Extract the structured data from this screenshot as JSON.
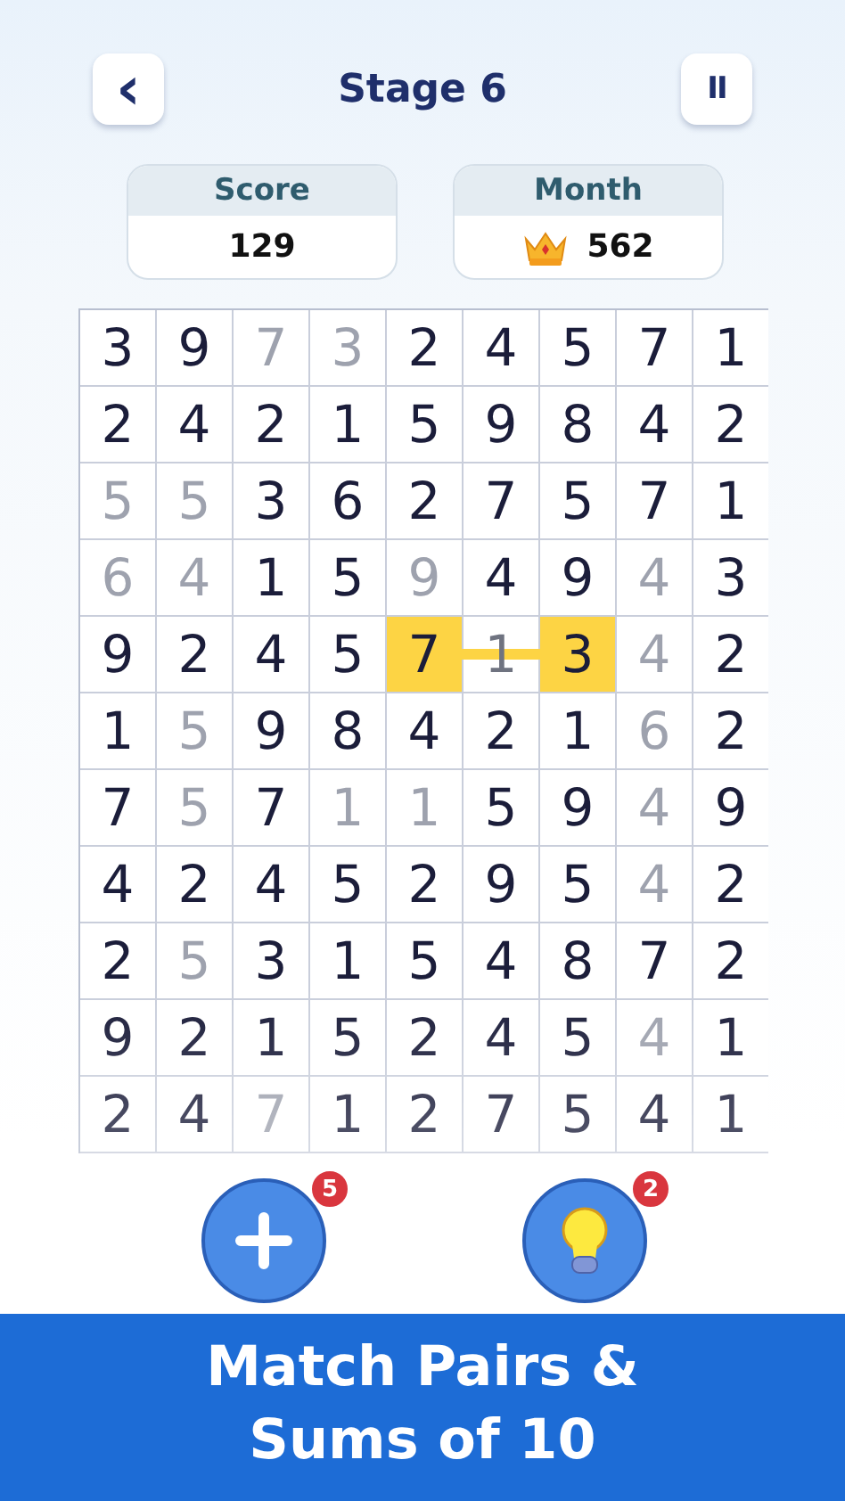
{
  "header": {
    "back_icon": "‹",
    "title": "Stage 6",
    "pause_icon": "II"
  },
  "stats": [
    {
      "label": "Score",
      "value": "129",
      "crown": false
    },
    {
      "label": "Month",
      "value": "562",
      "crown": true
    }
  ],
  "grid": {
    "rows": [
      [
        {
          "v": "3",
          "used": false,
          "selected": false
        },
        {
          "v": "9",
          "used": false,
          "selected": false
        },
        {
          "v": "7",
          "used": true,
          "selected": false
        },
        {
          "v": "3",
          "used": true,
          "selected": false
        },
        {
          "v": "2",
          "used": false,
          "selected": false
        },
        {
          "v": "4",
          "used": false,
          "selected": false
        },
        {
          "v": "5",
          "used": false,
          "selected": false
        },
        {
          "v": "7",
          "used": false,
          "selected": false
        },
        {
          "v": "1",
          "used": false,
          "selected": false
        }
      ],
      [
        {
          "v": "2",
          "used": false,
          "selected": false
        },
        {
          "v": "4",
          "used": false,
          "selected": false
        },
        {
          "v": "2",
          "used": false,
          "selected": false
        },
        {
          "v": "1",
          "used": false,
          "selected": false
        },
        {
          "v": "5",
          "used": false,
          "selected": false
        },
        {
          "v": "9",
          "used": false,
          "selected": false
        },
        {
          "v": "8",
          "used": false,
          "selected": false
        },
        {
          "v": "4",
          "used": false,
          "selected": false
        },
        {
          "v": "2",
          "used": false,
          "selected": false
        }
      ],
      [
        {
          "v": "5",
          "used": true,
          "selected": false
        },
        {
          "v": "5",
          "used": true,
          "selected": false
        },
        {
          "v": "3",
          "used": false,
          "selected": false
        },
        {
          "v": "6",
          "used": false,
          "selected": false
        },
        {
          "v": "2",
          "used": false,
          "selected": false
        },
        {
          "v": "7",
          "used": false,
          "selected": false
        },
        {
          "v": "5",
          "used": false,
          "selected": false
        },
        {
          "v": "7",
          "used": false,
          "selected": false
        },
        {
          "v": "1",
          "used": false,
          "selected": false
        }
      ],
      [
        {
          "v": "6",
          "used": true,
          "selected": false
        },
        {
          "v": "4",
          "used": true,
          "selected": false
        },
        {
          "v": "1",
          "used": false,
          "selected": false
        },
        {
          "v": "5",
          "used": false,
          "selected": false
        },
        {
          "v": "9",
          "used": true,
          "selected": false
        },
        {
          "v": "4",
          "used": false,
          "selected": false
        },
        {
          "v": "9",
          "used": false,
          "selected": false
        },
        {
          "v": "4",
          "used": true,
          "selected": false
        },
        {
          "v": "3",
          "used": false,
          "selected": false
        }
      ],
      [
        {
          "v": "9",
          "used": false,
          "selected": false
        },
        {
          "v": "2",
          "used": false,
          "selected": false
        },
        {
          "v": "4",
          "used": false,
          "selected": false
        },
        {
          "v": "5",
          "used": false,
          "selected": false
        },
        {
          "v": "7",
          "used": false,
          "selected": true
        },
        {
          "v": "1",
          "used": true,
          "selected": false,
          "linked": true
        },
        {
          "v": "3",
          "used": false,
          "selected": true
        },
        {
          "v": "4",
          "used": true,
          "selected": false
        },
        {
          "v": "2",
          "used": false,
          "selected": false
        }
      ],
      [
        {
          "v": "1",
          "used": false,
          "selected": false
        },
        {
          "v": "5",
          "used": true,
          "selected": false
        },
        {
          "v": "9",
          "used": false,
          "selected": false
        },
        {
          "v": "8",
          "used": false,
          "selected": false
        },
        {
          "v": "4",
          "used": false,
          "selected": false
        },
        {
          "v": "2",
          "used": false,
          "selected": false
        },
        {
          "v": "1",
          "used": false,
          "selected": false
        },
        {
          "v": "6",
          "used": true,
          "selected": false
        },
        {
          "v": "2",
          "used": false,
          "selected": false
        }
      ],
      [
        {
          "v": "7",
          "used": false,
          "selected": false
        },
        {
          "v": "5",
          "used": true,
          "selected": false
        },
        {
          "v": "7",
          "used": false,
          "selected": false
        },
        {
          "v": "1",
          "used": true,
          "selected": false
        },
        {
          "v": "1",
          "used": true,
          "selected": false
        },
        {
          "v": "5",
          "used": false,
          "selected": false
        },
        {
          "v": "9",
          "used": false,
          "selected": false
        },
        {
          "v": "4",
          "used": true,
          "selected": false
        },
        {
          "v": "9",
          "used": false,
          "selected": false
        }
      ],
      [
        {
          "v": "4",
          "used": false,
          "selected": false
        },
        {
          "v": "2",
          "used": false,
          "selected": false
        },
        {
          "v": "4",
          "used": false,
          "selected": false
        },
        {
          "v": "5",
          "used": false,
          "selected": false
        },
        {
          "v": "2",
          "used": false,
          "selected": false
        },
        {
          "v": "9",
          "used": false,
          "selected": false
        },
        {
          "v": "5",
          "used": false,
          "selected": false
        },
        {
          "v": "4",
          "used": true,
          "selected": false
        },
        {
          "v": "2",
          "used": false,
          "selected": false
        }
      ],
      [
        {
          "v": "2",
          "used": false,
          "selected": false
        },
        {
          "v": "5",
          "used": true,
          "selected": false
        },
        {
          "v": "3",
          "used": false,
          "selected": false
        },
        {
          "v": "1",
          "used": false,
          "selected": false
        },
        {
          "v": "5",
          "used": false,
          "selected": false
        },
        {
          "v": "4",
          "used": false,
          "selected": false
        },
        {
          "v": "8",
          "used": false,
          "selected": false
        },
        {
          "v": "7",
          "used": false,
          "selected": false
        },
        {
          "v": "2",
          "used": false,
          "selected": false
        }
      ],
      [
        {
          "v": "9",
          "used": false,
          "selected": false
        },
        {
          "v": "2",
          "used": false,
          "selected": false
        },
        {
          "v": "1",
          "used": false,
          "selected": false
        },
        {
          "v": "5",
          "used": false,
          "selected": false
        },
        {
          "v": "2",
          "used": false,
          "selected": false
        },
        {
          "v": "4",
          "used": false,
          "selected": false
        },
        {
          "v": "5",
          "used": false,
          "selected": false
        },
        {
          "v": "4",
          "used": true,
          "selected": false
        },
        {
          "v": "1",
          "used": false,
          "selected": false
        }
      ],
      [
        {
          "v": "2",
          "used": false,
          "selected": false
        },
        {
          "v": "4",
          "used": false,
          "selected": false
        },
        {
          "v": "7",
          "used": true,
          "selected": false
        },
        {
          "v": "1",
          "used": false,
          "selected": false
        },
        {
          "v": "2",
          "used": false,
          "selected": false
        },
        {
          "v": "7",
          "used": false,
          "selected": false
        },
        {
          "v": "5",
          "used": false,
          "selected": false
        },
        {
          "v": "4",
          "used": false,
          "selected": false
        },
        {
          "v": "1",
          "used": false,
          "selected": false
        }
      ]
    ]
  },
  "actions": [
    {
      "kind": "add",
      "badge": "5"
    },
    {
      "kind": "hint",
      "badge": "2"
    }
  ],
  "banner": {
    "lines": [
      "Match Pairs &",
      "Sums of 10"
    ]
  }
}
